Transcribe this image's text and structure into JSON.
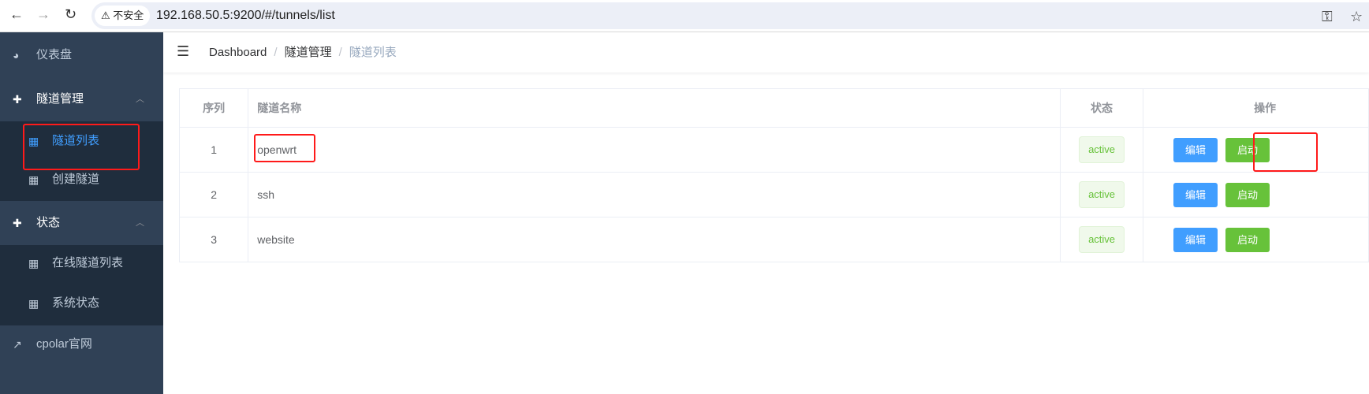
{
  "browser": {
    "insecure_label": "不安全",
    "url": "192.168.50.5:9200/#/tunnels/list"
  },
  "sidebar": {
    "dashboard": "仪表盘",
    "tunnel_mgmt": "隧道管理",
    "tunnel_list": "隧道列表",
    "create_tunnel": "创建隧道",
    "status": "状态",
    "online_tunnels": "在线隧道列表",
    "system_status": "系统状态",
    "cpolar_site": "cpolar官网"
  },
  "breadcrumb": [
    "Dashboard",
    "隧道管理",
    "隧道列表"
  ],
  "table": {
    "headers": [
      "序列",
      "隧道名称",
      "状态",
      "操作"
    ],
    "rows": [
      {
        "index": "1",
        "name": "openwrt",
        "status": "active"
      },
      {
        "index": "2",
        "name": "ssh",
        "status": "active"
      },
      {
        "index": "3",
        "name": "website",
        "status": "active"
      }
    ],
    "edit_label": "编辑",
    "start_label": "启动"
  },
  "colors": {
    "sidebar_bg": "#304156",
    "submenu_bg": "#1f2d3d",
    "active": "#409eff",
    "success": "#67c23a",
    "annotation": "#ff1a1a"
  }
}
